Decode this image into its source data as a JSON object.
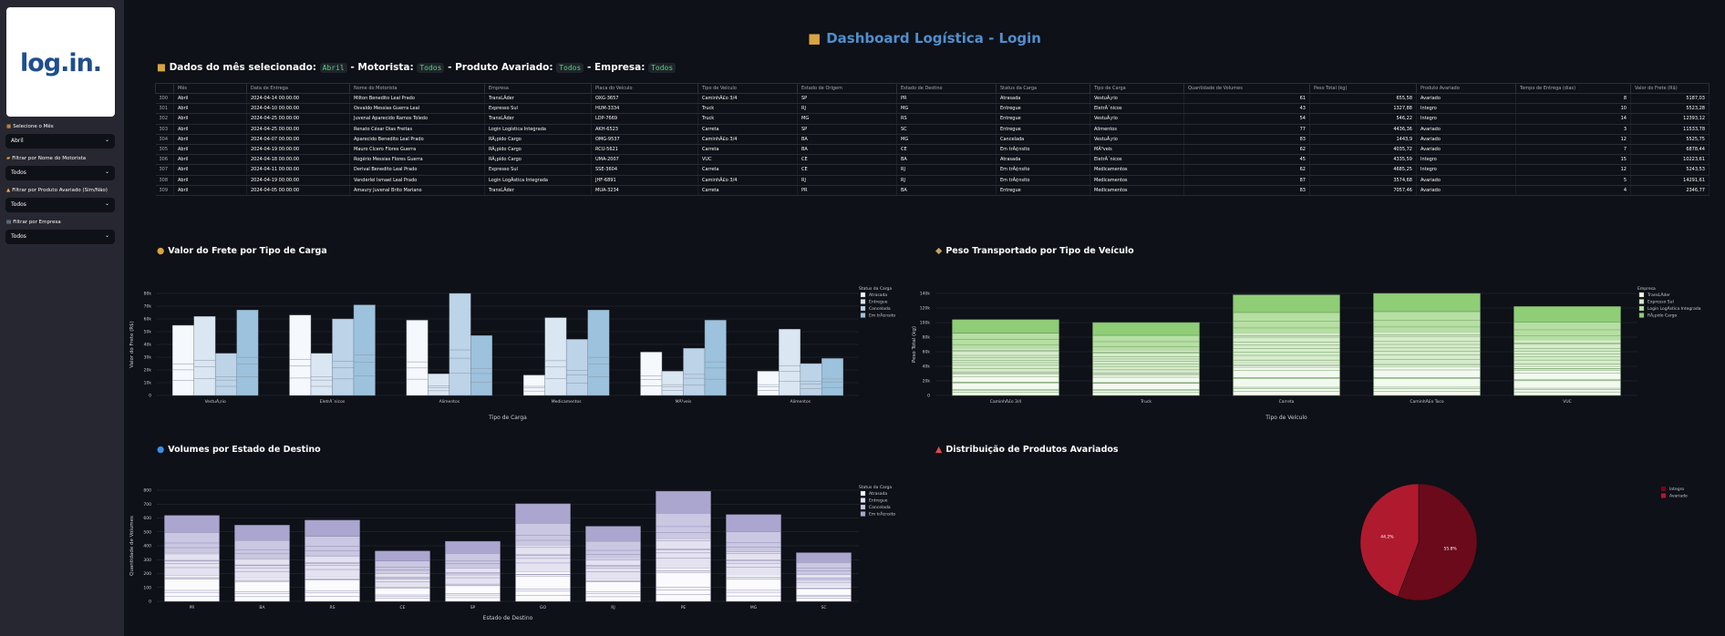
{
  "colors": {
    "accent": "#4f8fce",
    "code_green": "#5bd07a",
    "bg": "#0e1117",
    "sidebar": "#262730",
    "pie_integro": "#6b0a1b",
    "pie_avariado": "#b01a2e"
  },
  "sidebar": {
    "logo_text": "log.in.",
    "filters": [
      {
        "icon": "calendar-icon",
        "label": "Selecione o Mês",
        "value": "Abril"
      },
      {
        "icon": "truck-icon",
        "label": "Filtrar por Nome do Motorista",
        "value": "Todos"
      },
      {
        "icon": "warning-icon",
        "label": "Filtrar por Produto Avariado (Sim/Não)",
        "value": "Todos"
      },
      {
        "icon": "building-icon",
        "label": "Filtrar por Empresa",
        "value": "Todos"
      }
    ]
  },
  "header": {
    "title": "Dashboard Logística - Login"
  },
  "filters_line": {
    "prefix": "Dados do mês selecionado:",
    "month": "Abril",
    "driver_label": "- Motorista:",
    "driver": "Todos",
    "damaged_label": "- Produto Avariado:",
    "damaged": "Todos",
    "company_label": "- Empresa:",
    "company": "Todos"
  },
  "table": {
    "columns": [
      "Mês",
      "Data de Entrega",
      "Nome do Motorista",
      "Empresa",
      "Placa do Veículo",
      "Tipo de Veículo",
      "Estado de Origem",
      "Estado de Destino",
      "Status da Carga",
      "Tipo de Carga",
      "Quantidade de Volumes",
      "Peso Total (kg)",
      "Produto Avariado",
      "Tempo de Entrega (dias)",
      "Valor do Frete (R$)"
    ],
    "rows": [
      [
        "300",
        "Abril",
        "2024-04-14 00:00:00",
        "Milton Benedito Leal Prado",
        "TransLÃder",
        "OXG-3657",
        "CaminhÃ£o 3/4",
        "SP",
        "PR",
        "Atrasada",
        "VestuÃ¡rio",
        "61",
        "655,58",
        "Avariado",
        "8",
        "5187,03"
      ],
      [
        "301",
        "Abril",
        "2024-04-10 00:00:00",
        "Osvaldo Messias Guerra Leal",
        "Expresso Sul",
        "HUM-3334",
        "Truck",
        "RJ",
        "MG",
        "Entregue",
        "EletrÃ´nicos",
        "43",
        "1327,88",
        "Integro",
        "10",
        "5523,28"
      ],
      [
        "302",
        "Abril",
        "2024-04-25 00:00:00",
        "Juvenal Aparecido Ramos Toledo",
        "TransLÃder",
        "LDP-7669",
        "Truck",
        "MG",
        "RS",
        "Entregue",
        "VestuÃ¡rio",
        "54",
        "546,22",
        "Integro",
        "14",
        "12393,12"
      ],
      [
        "303",
        "Abril",
        "2024-04-25 00:00:00",
        "Renato César Dias Freitas",
        "Login Logística Integrada",
        "AKH-6523",
        "Carreta",
        "SP",
        "SC",
        "Entregue",
        "Alimentos",
        "77",
        "4436,36",
        "Avariado",
        "3",
        "11533,78"
      ],
      [
        "304",
        "Abril",
        "2024-04-07 00:00:00",
        "Aparecido Benedito Leal Prado",
        "RÃ¡pido Cargo",
        "OMG-9537",
        "CaminhÃ£o 3/4",
        "BA",
        "MG",
        "Cancelada",
        "VestuÃ¡rio",
        "83",
        "1443,9",
        "Avariado",
        "12",
        "5525,75"
      ],
      [
        "305",
        "Abril",
        "2024-04-19 00:00:00",
        "Mauro Cícero Flores Guerra",
        "RÃ¡pido Cargo",
        "RCU-5621",
        "Carreta",
        "BA",
        "CE",
        "Em trÃ¢nsito",
        "MÃ³veis",
        "62",
        "4035,72",
        "Avariado",
        "7",
        "6878,44"
      ],
      [
        "306",
        "Abril",
        "2024-04-18 00:00:00",
        "Rogério Messias Flores Guerra",
        "RÃ¡pido Cargo",
        "UMA-2007",
        "VUC",
        "CE",
        "BA",
        "Atrasada",
        "EletrÃ´nicos",
        "45",
        "4335,59",
        "Integro",
        "15",
        "10223,61"
      ],
      [
        "307",
        "Abril",
        "2024-04-11 00:00:00",
        "Derival Benedito Leal Prado",
        "Expresso Sul",
        "SSE-3604",
        "Carreta",
        "CE",
        "RJ",
        "Em trÃ¢nsito",
        "Medicamentos",
        "62",
        "4685,25",
        "Integro",
        "12",
        "5243,53"
      ],
      [
        "308",
        "Abril",
        "2024-04-19 00:00:00",
        "Vanderlei Ismael Leal Prado",
        "Login LogÃ­stica Integrada",
        "JHF-6891",
        "CaminhÃ£o 3/4",
        "RJ",
        "RJ",
        "Em trÃ¢nsito",
        "Medicamentos",
        "87",
        "3574,68",
        "Avariado",
        "5",
        "14291,61"
      ],
      [
        "309",
        "Abril",
        "2024-04-05 00:00:00",
        "Amaury Juvenal Brito Mariano",
        "TransLÃder",
        "MUA-3234",
        "Carreta",
        "PR",
        "BA",
        "Entregue",
        "Medicamentos",
        "83",
        "7057,46",
        "Avariado",
        "4",
        "2346,77"
      ]
    ]
  },
  "sections": {
    "frete": "Valor do Frete por Tipo de Carga",
    "peso": "Peso Transportado por Tipo de Veículo",
    "volumes": "Volumes por Estado de Destino",
    "avariados": "Distribuição de Produtos Avariados"
  },
  "chart_data": [
    {
      "type": "bar",
      "title": "",
      "xlabel": "Tipo de Carga",
      "ylabel": "Valor do Frete (R$)",
      "ylim": [
        0,
        80000
      ],
      "yticks": [
        "0",
        "10k",
        "20k",
        "30k",
        "40k",
        "50k",
        "60k",
        "70k",
        "80k"
      ],
      "categories": [
        "VestuÃ¡rio",
        "EletrÃ´nicos",
        "Alimentos",
        "Medicamentos",
        "MÃ³veis",
        "Alimentos"
      ],
      "legend_title": "Status da Carga",
      "legend_position": "top-right",
      "series": [
        {
          "name": "Atrasada",
          "color": "#f5f8fc",
          "values": [
            55000,
            63000,
            59000,
            16000,
            34000,
            19000
          ]
        },
        {
          "name": "Entregue",
          "color": "#dae6f2",
          "values": [
            62000,
            33000,
            17000,
            61000,
            19000,
            52000
          ]
        },
        {
          "name": "Cancelada",
          "color": "#bcd3e8",
          "values": [
            33000,
            60000,
            80000,
            44000,
            37000,
            25000
          ]
        },
        {
          "name": "Em trÃ¢nsito",
          "color": "#9cc2dd",
          "values": [
            67000,
            71000,
            47000,
            67000,
            59000,
            29000
          ]
        }
      ]
    },
    {
      "type": "bar",
      "title": "",
      "xlabel": "Tipo de Veículo",
      "ylabel": "Peso Total (kg)",
      "ylim": [
        0,
        140000
      ],
      "yticks": [
        "0",
        "20k",
        "40k",
        "60k",
        "80k",
        "100k",
        "120k",
        "140k"
      ],
      "categories": [
        "CaminhÃ£o 3/4",
        "Truck",
        "Carreta",
        "CaminhÃ£o Toco",
        "VUC"
      ],
      "values": [
        104000,
        100000,
        138000,
        140000,
        122000
      ],
      "legend_title": "Empresa",
      "legend_position": "top-right",
      "legend": [
        {
          "name": "TransLÃder",
          "color": "#f2f9ee"
        },
        {
          "name": "Expresso Sul",
          "color": "#d6eccb"
        },
        {
          "name": "Login LogÃ­stica Integrada",
          "color": "#b6dfa3"
        },
        {
          "name": "RÃ¡pido Cargo",
          "color": "#8fcd77"
        }
      ]
    },
    {
      "type": "bar",
      "title": "",
      "xlabel": "Estado de Destino",
      "ylabel": "Quantidade de Volumes",
      "ylim": [
        0,
        800
      ],
      "yticks": [
        "0",
        "100",
        "200",
        "300",
        "400",
        "500",
        "600",
        "700",
        "800"
      ],
      "categories": [
        "PR",
        "BA",
        "RS",
        "CE",
        "SP",
        "GO",
        "RJ",
        "PE",
        "MG",
        "SC"
      ],
      "values": [
        618,
        548,
        584,
        362,
        432,
        702,
        540,
        792,
        624,
        350
      ],
      "legend_title": "Status da Carga",
      "legend_position": "top-right",
      "legend": [
        {
          "name": "Atrasada",
          "color": "#fbfbfd"
        },
        {
          "name": "Entregue",
          "color": "#e4e2f0"
        },
        {
          "name": "Cancelada",
          "color": "#cac7e2"
        },
        {
          "name": "Em trÃ¢nsito",
          "color": "#aaa6cf"
        }
      ]
    },
    {
      "type": "pie",
      "title": "",
      "labels": [
        "Integro",
        "Avariado"
      ],
      "values": [
        55.8,
        44.2
      ],
      "value_labels": [
        "55.8%",
        "44.2%"
      ],
      "colors": [
        "#6b0a1b",
        "#b01a2e"
      ],
      "legend_position": "top-right"
    }
  ]
}
